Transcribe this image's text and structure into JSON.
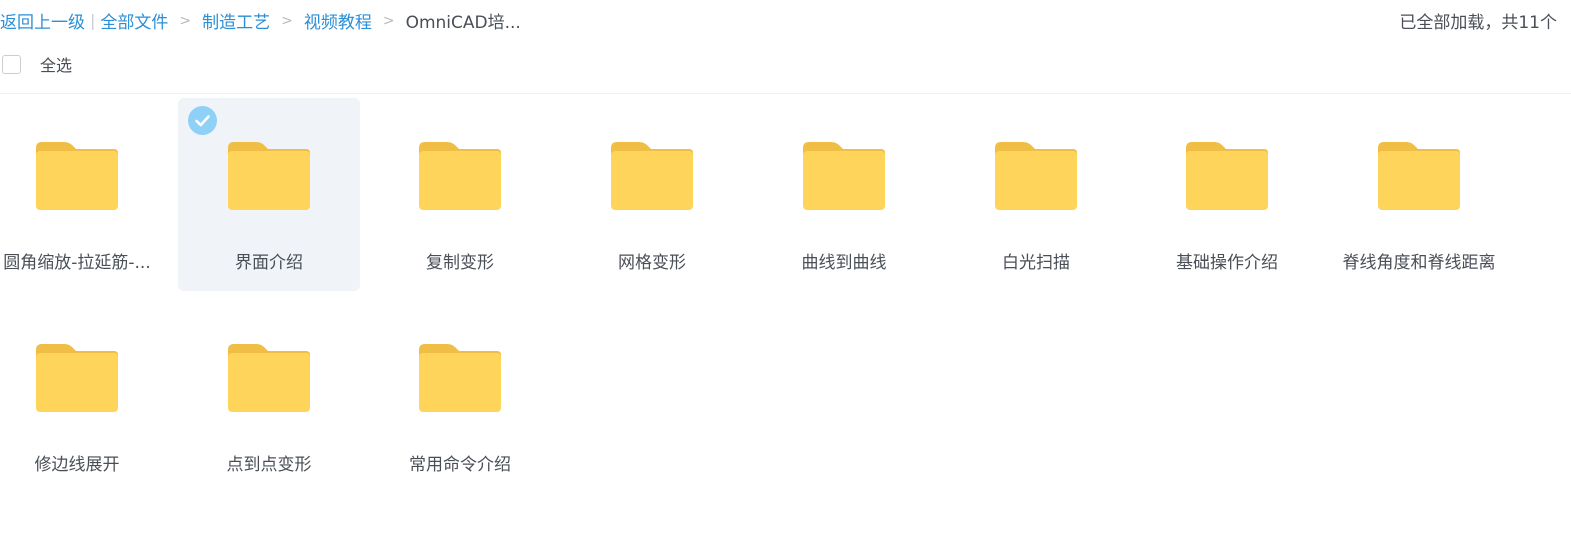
{
  "breadcrumb": {
    "back": "返回上一级",
    "items": [
      "全部文件",
      "制造工艺",
      "视频教程"
    ],
    "current": "OmniCAD培..."
  },
  "status": "已全部加载，共11个",
  "select_all_label": "全选",
  "folders": [
    {
      "name": "圆角缩放-拉延筋-...",
      "selected": false
    },
    {
      "name": "界面介绍",
      "selected": true
    },
    {
      "name": "复制变形",
      "selected": false
    },
    {
      "name": "网格变形",
      "selected": false
    },
    {
      "name": "曲线到曲线",
      "selected": false
    },
    {
      "name": "白光扫描",
      "selected": false
    },
    {
      "name": "基础操作介绍",
      "selected": false
    },
    {
      "name": "脊线角度和脊线距离",
      "selected": false
    },
    {
      "name": "修边线展开",
      "selected": false
    },
    {
      "name": "点到点变形",
      "selected": false
    },
    {
      "name": "常用命令介绍",
      "selected": false
    }
  ],
  "colors": {
    "link": "#2b8fd6",
    "text": "#4a4f57",
    "folder_body": "#ffd45a",
    "folder_tab": "#f0bd45",
    "selected_bg": "#f0f3f8",
    "check_badge": "#8fd0f7"
  },
  "icons": {
    "folder": "folder-icon",
    "check": "check-circle-icon"
  }
}
